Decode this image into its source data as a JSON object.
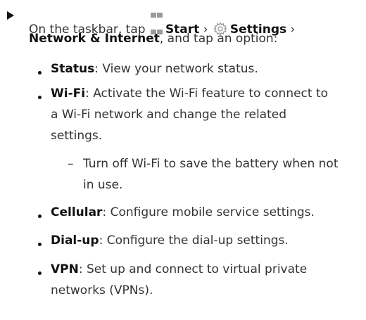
{
  "step": {
    "line1_prefix": "On the taskbar, tap ",
    "start_label": "Start",
    "sep1": " › ",
    "settings_label": "Settings",
    "sep2": " ›",
    "network_label": "Network & Internet",
    "line2_suffix": ", and tap an option:"
  },
  "items": [
    {
      "term": "Status",
      "desc_lines": [
        ": View your network status."
      ]
    },
    {
      "term": "Wi-Fi",
      "desc_lines": [
        ": Activate the Wi-Fi feature to connect to",
        "a Wi-Fi network and change the related",
        "settings."
      ]
    },
    {
      "term": "Cellular",
      "desc_lines": [
        ": Configure mobile service settings."
      ]
    },
    {
      "term": "Dial-up",
      "desc_lines": [
        ": Configure the dial-up settings."
      ]
    },
    {
      "term": "VPN",
      "desc_lines": [
        ": Set up and connect to virtual private",
        "networks (VPNs)."
      ]
    }
  ],
  "wifi_sub": {
    "dash": "–",
    "lines": [
      "Turn off Wi-Fi to save the battery when not",
      "in use."
    ]
  },
  "icons": {
    "start": "windows-logo",
    "settings": "gear"
  },
  "colors": {
    "text": "#333333",
    "bold": "#111111",
    "icon": "#9a9a9a"
  }
}
